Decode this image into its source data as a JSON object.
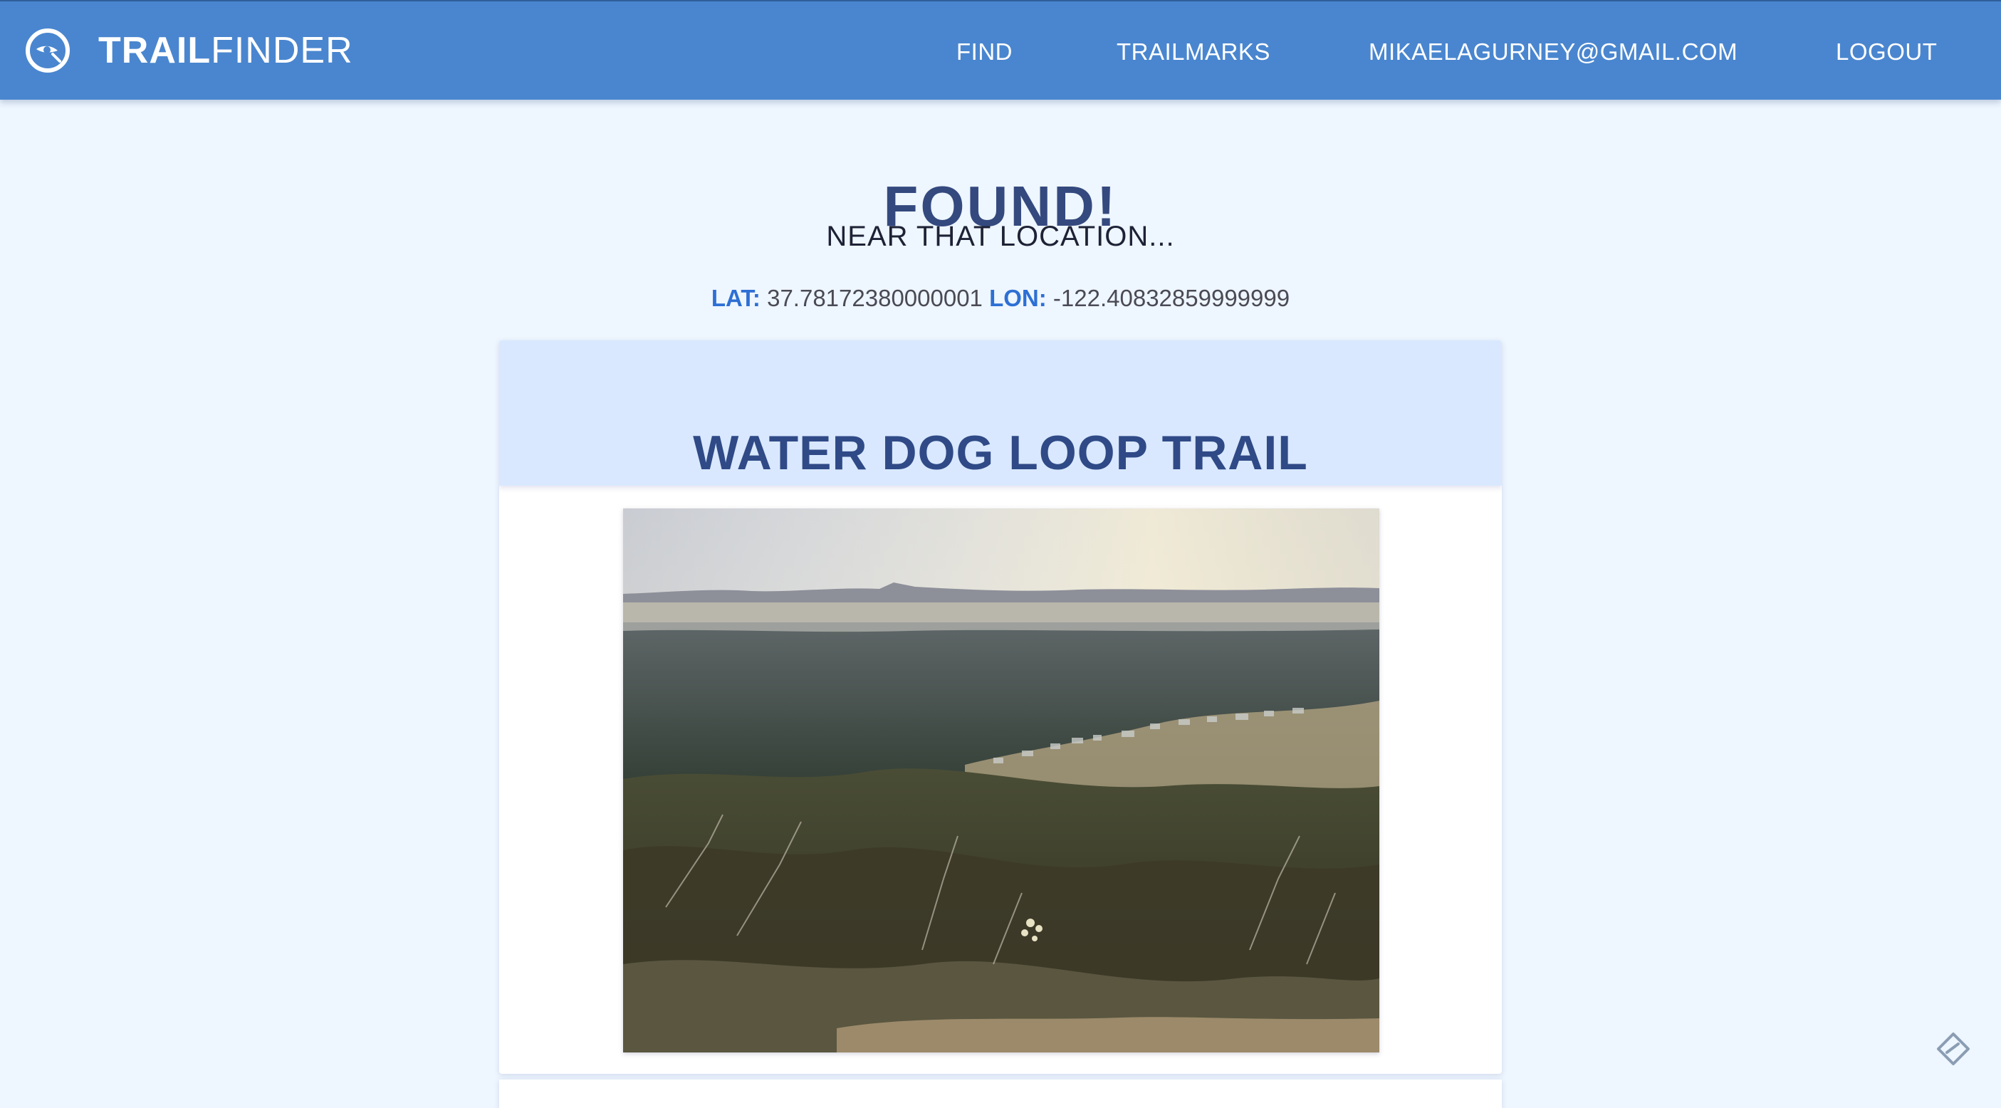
{
  "navbar": {
    "brand_strong": "TRAIL",
    "brand_light": "FINDER",
    "brand_icon": "compass-icon",
    "links": {
      "find": "FIND",
      "trailmarks": "TRAILMARKS",
      "email": "MIKAELAGURNEY@GMAIL.COM",
      "logout": "LOGOUT"
    }
  },
  "result": {
    "title": "FOUND!",
    "subtitle": "NEAR THAT LOCATION...",
    "lat_label": "LAT:",
    "lat_value": "37.78172380000001",
    "lon_label": "LON:",
    "lon_value": "-122.40832859999999"
  },
  "trail": {
    "name": "WATER DOG LOOP TRAIL",
    "photo_icon": "trail-landscape-photo"
  },
  "colors": {
    "navbar": "#4a86cf",
    "background": "#eef6ff",
    "card_header": "#d9e8ff",
    "accent_blue": "#2d6fd4",
    "title_text": "#34497e"
  },
  "corner_icon": "feedback-icon"
}
